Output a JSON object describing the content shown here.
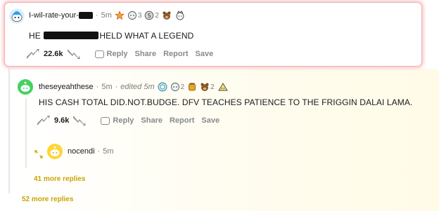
{
  "comment1": {
    "author": "I-wil-rate-your-",
    "time": "5m",
    "award_counts": [
      "3",
      "2"
    ],
    "body_start": "HE",
    "body_end": "HELD WHAT A LEGEND",
    "votes": "22.6k",
    "reply": "Reply",
    "share": "Share",
    "report": "Report",
    "save": "Save"
  },
  "comment2": {
    "author": "theseyeahthese",
    "time": "5m",
    "edited": "edited 5m",
    "award_counts": [
      "2",
      "2"
    ],
    "body": "HIS CASH TOTAL DID.NOT.BUDGE. DFV TEACHES PATIENCE TO THE FRIGGIN DALAI LAMA.",
    "votes": "9.6k",
    "reply": "Reply",
    "share": "Share",
    "report": "Report",
    "save": "Save"
  },
  "comment3": {
    "author": "nocendi",
    "time": "5m"
  },
  "more_replies_inner": "41 more replies",
  "more_replies_outer": "52 more replies",
  "colors": {
    "highlight_border": "#f2b3b3",
    "more_link": "#c9a400",
    "meta": "#7c7c7c",
    "action": "#878a8c"
  }
}
